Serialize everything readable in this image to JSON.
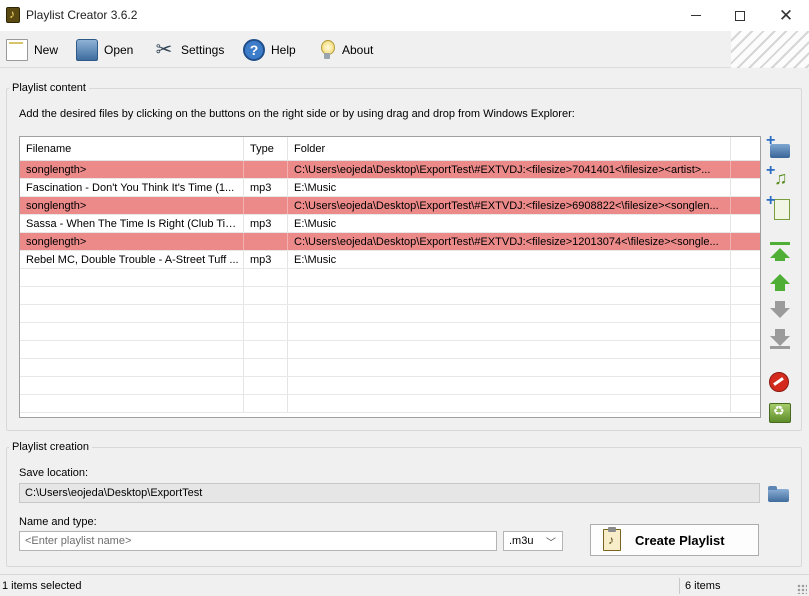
{
  "window": {
    "title": "Playlist Creator 3.6.2"
  },
  "toolbar": {
    "new_label": "New",
    "open_label": "Open",
    "settings_label": "Settings",
    "help_label": "Help",
    "about_label": "About"
  },
  "content": {
    "group_label": "Playlist content",
    "instructions": "Add the desired files by clicking on the buttons on the right side or by using drag and drop from Windows Explorer:",
    "columns": [
      "Filename",
      "Type",
      "Folder",
      ""
    ],
    "rows": [
      {
        "filename": "songlength>",
        "type": "",
        "folder": "C:\\Users\\eojeda\\Desktop\\ExportTest\\#EXTVDJ:<filesize>7041401<\\filesize><artist>...",
        "error": true
      },
      {
        "filename": "Fascination - Don't You Think It's Time  (1...",
        "type": "mp3",
        "folder": "E:\\Music",
        "error": false
      },
      {
        "filename": "songlength>",
        "type": "",
        "folder": "C:\\Users\\eojeda\\Desktop\\ExportTest\\#EXTVDJ:<filesize>6908822<\\filesize><songlen...",
        "error": true
      },
      {
        "filename": "Sassa - When The Time Is Right (Club Tim...",
        "type": "mp3",
        "folder": "E:\\Music",
        "error": false
      },
      {
        "filename": "songlength>",
        "type": "",
        "folder": "C:\\Users\\eojeda\\Desktop\\ExportTest\\#EXTVDJ:<filesize>12013074<\\filesize><songle...",
        "error": true
      },
      {
        "filename": "Rebel MC, Double Trouble - A-Street Tuff ...",
        "type": "mp3",
        "folder": "E:\\Music",
        "error": false
      }
    ],
    "error_row_color": "#ec8a8a"
  },
  "creation": {
    "group_label": "Playlist creation",
    "save_location_label": "Save location:",
    "save_location_value": "C:\\Users\\eojeda\\Desktop\\ExportTest",
    "name_type_label": "Name and type:",
    "name_placeholder": "<Enter playlist name>",
    "type_value": ".m3u",
    "create_button_label": "Create Playlist"
  },
  "status": {
    "selected": "1 items selected",
    "count": "6 items"
  },
  "icons": {
    "side": [
      "add-folder-icon",
      "add-file-icon",
      "add-playlist-icon",
      "move-top-icon",
      "move-up-icon",
      "move-down-icon",
      "move-bottom-icon",
      "remove-icon",
      "clear-icon"
    ]
  }
}
